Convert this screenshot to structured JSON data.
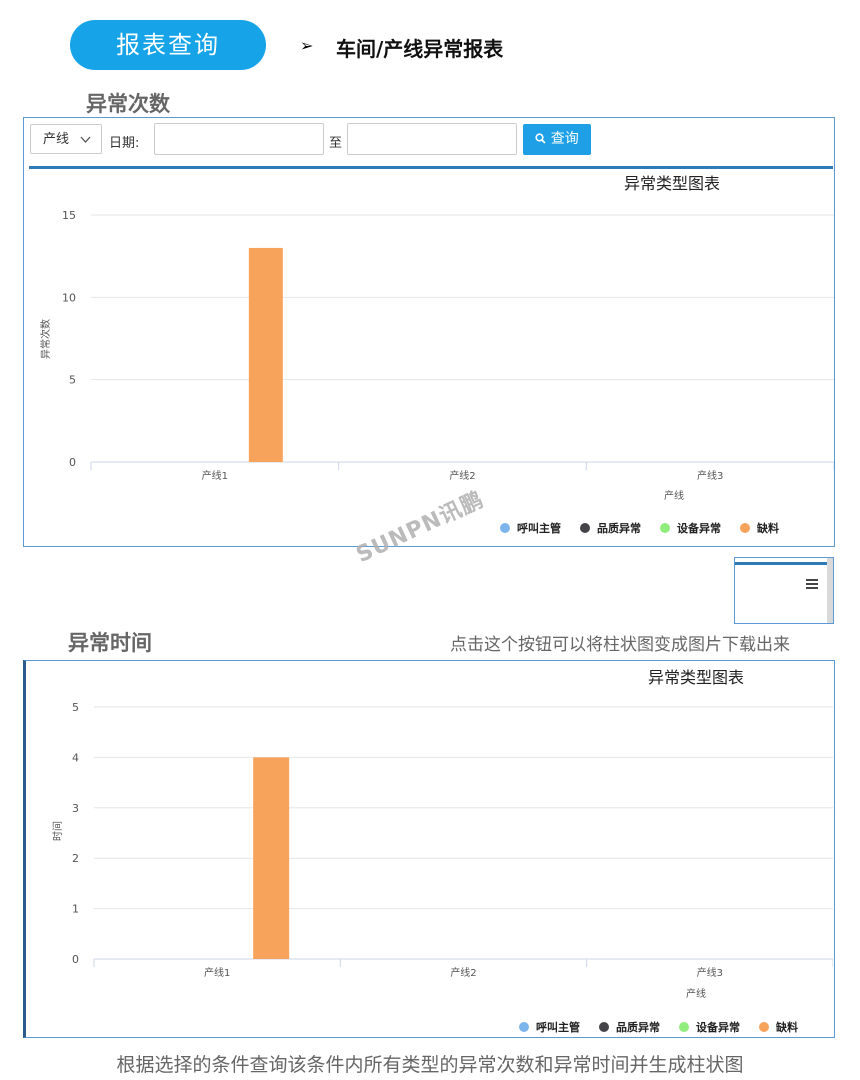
{
  "header": {
    "pill": "报表查询",
    "arrow": "➢",
    "crumb": "车间/产线异常报表"
  },
  "section1": {
    "title": "异常次数"
  },
  "filter": {
    "dropdown": "产线",
    "date_label": "日期:",
    "to_label": "至",
    "query_button": "查询",
    "start_date": "",
    "end_date": ""
  },
  "section2": {
    "title": "异常时间"
  },
  "hint": "点击这个按钮可以将柱状图变成图片下载出来",
  "caption": "根据选择的条件查询该条件内所有类型的异常次数和异常时间并生成柱状图",
  "watermark": "SUNPN讯鹏",
  "icons": {
    "menu": "hamburger-menu-icon",
    "search": "search-icon",
    "chevron": "chevron-down-icon"
  },
  "chart_data": [
    {
      "type": "bar",
      "title": "异常类型图表",
      "xlabel": "产线",
      "ylabel": "异常次数",
      "categories": [
        "产线1",
        "产线2",
        "产线3"
      ],
      "ylim": [
        0,
        15
      ],
      "yticks": [
        0,
        5,
        10,
        15
      ],
      "legend_position": "bottom-right",
      "series": [
        {
          "name": "呼叫主管",
          "color": "#7cb5ec",
          "values": [
            0,
            0,
            0
          ]
        },
        {
          "name": "品质异常",
          "color": "#434348",
          "values": [
            0,
            0,
            0
          ]
        },
        {
          "name": "设备异常",
          "color": "#90ed7d",
          "values": [
            0,
            0,
            0
          ]
        },
        {
          "name": "缺料",
          "color": "#f7a35c",
          "values": [
            13,
            0,
            0
          ]
        }
      ]
    },
    {
      "type": "bar",
      "title": "异常类型图表",
      "xlabel": "产线",
      "ylabel": "时间",
      "categories": [
        "产线1",
        "产线2",
        "产线3"
      ],
      "ylim": [
        0,
        5
      ],
      "yticks": [
        0,
        1,
        2,
        3,
        4,
        5
      ],
      "legend_position": "bottom-right",
      "series": [
        {
          "name": "呼叫主管",
          "color": "#7cb5ec",
          "values": [
            0,
            0,
            0
          ]
        },
        {
          "name": "品质异常",
          "color": "#434348",
          "values": [
            0,
            0,
            0
          ]
        },
        {
          "name": "设备异常",
          "color": "#90ed7d",
          "values": [
            0,
            0,
            0
          ]
        },
        {
          "name": "缺料",
          "color": "#f7a35c",
          "values": [
            4,
            0,
            0
          ]
        }
      ]
    }
  ]
}
